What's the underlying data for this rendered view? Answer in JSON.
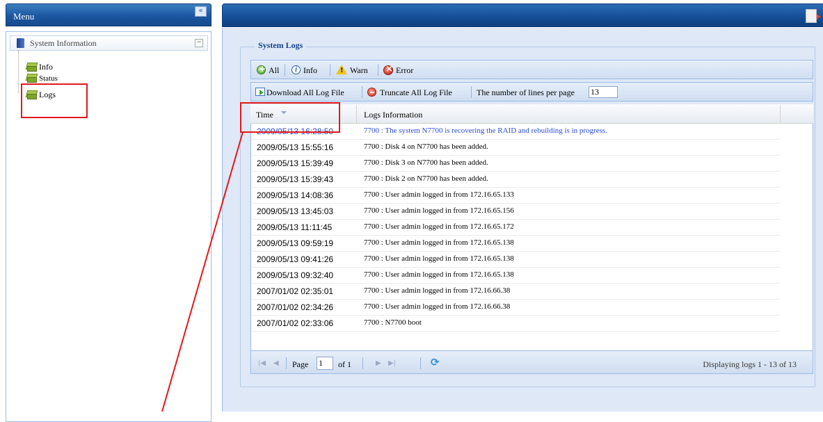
{
  "menu": {
    "title": "Menu",
    "collapse_glyph": "«",
    "tree": {
      "root_label": "System Information",
      "root_toggle": "−",
      "items": [
        {
          "label": "Info"
        },
        {
          "label": "Status"
        },
        {
          "label": "Logs"
        }
      ]
    }
  },
  "panel": {
    "legend": "System Logs",
    "filters": {
      "all": "All",
      "info": "Info",
      "warn": "Warn",
      "error": "Error"
    },
    "actions": {
      "download": "Download All Log File",
      "truncate": "Truncate All Log File",
      "lines_label": "The number of lines per page",
      "lines_value": "13"
    },
    "grid": {
      "columns": [
        "Time",
        "Logs Information"
      ],
      "rows": [
        {
          "time": "2009/05/13 16:28:50",
          "info": "7700 : The system N7700 is recovering the RAID and rebuilding is in progress."
        },
        {
          "time": "2009/05/13 15:55:16",
          "info": "7700 : Disk 4 on N7700 has been added."
        },
        {
          "time": "2009/05/13 15:39:49",
          "info": "7700 : Disk 3 on N7700 has been added."
        },
        {
          "time": "2009/05/13 15:39:43",
          "info": "7700 : Disk 2 on N7700 has been added."
        },
        {
          "time": "2009/05/13 14:08:36",
          "info": "7700 : User admin logged in from 172.16.65.133"
        },
        {
          "time": "2009/05/13 13:45:03",
          "info": "7700 : User admin logged in from 172.16.65.156"
        },
        {
          "time": "2009/05/13 11:11:45",
          "info": "7700 : User admin logged in from 172.16.65.172"
        },
        {
          "time": "2009/05/13 09:59:19",
          "info": "7700 : User admin logged in from 172.16.65.138"
        },
        {
          "time": "2009/05/13 09:41:26",
          "info": "7700 : User admin logged in from 172.16.65.138"
        },
        {
          "time": "2009/05/13 09:32:40",
          "info": "7700 : User admin logged in from 172.16.65.138"
        },
        {
          "time": "2007/01/02 02:35:01",
          "info": "7700 : User admin logged in from 172.16.66.38"
        },
        {
          "time": "2007/01/02 02:34:26",
          "info": "7700 : User admin logged in from 172.16.66.38"
        },
        {
          "time": "2007/01/02 02:33:06",
          "info": "7700 : N7700 boot"
        }
      ]
    },
    "paging": {
      "page_label": "Page",
      "page_value": "1",
      "of_label": "of 1",
      "displaying": "Displaying logs 1 - 13 of 13"
    }
  },
  "colors": {
    "header_blue": "#1b56a0",
    "highlight_red": "#e3171b",
    "first_row_text": "#2a4bd6"
  },
  "icons": [
    "collapse-icon",
    "system-info-icon",
    "tree-leaf-icon",
    "logout-icon",
    "add-icon",
    "info-icon",
    "warning-icon",
    "error-icon",
    "download-icon",
    "truncate-icon",
    "first-page-icon",
    "prev-page-icon",
    "next-page-icon",
    "last-page-icon",
    "refresh-icon",
    "sort-desc-icon"
  ]
}
